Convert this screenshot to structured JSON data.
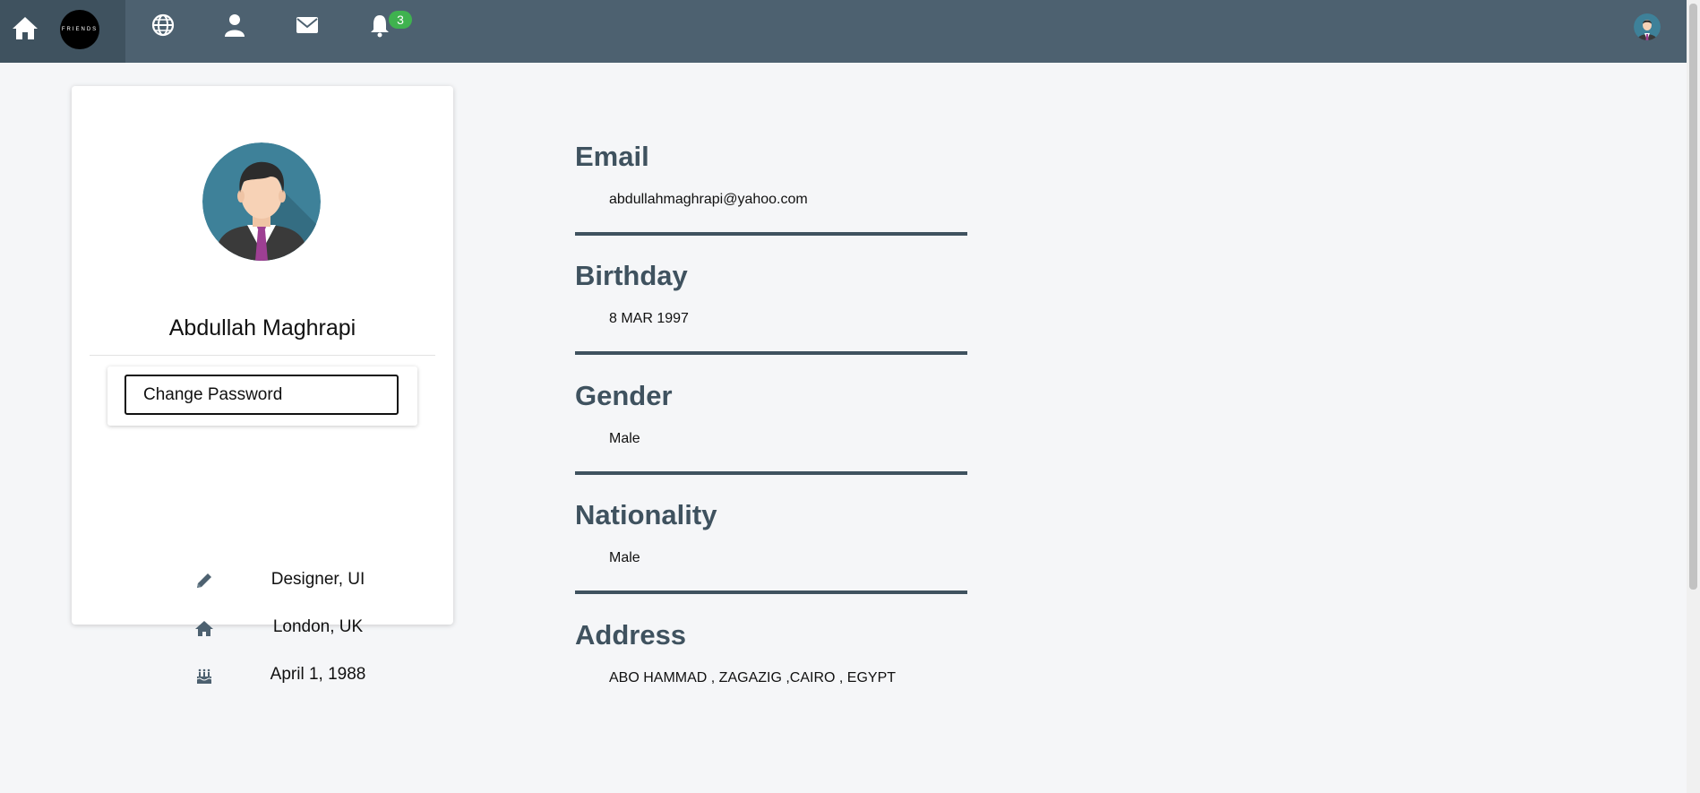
{
  "navbar": {
    "logo_text": "FRIENDS",
    "notification_count": "3",
    "icons": [
      "home-icon",
      "globe-icon",
      "user-icon",
      "envelope-icon",
      "bell-icon"
    ]
  },
  "profile": {
    "name": "Abdullah Maghrapi",
    "change_password_label": "Change Password",
    "job": "Designer, UI",
    "location": "London, UK",
    "birthday": "April 1, 1988"
  },
  "details": [
    {
      "label": "Email",
      "value": "abdullahmaghrapi@yahoo.com"
    },
    {
      "label": "Birthday",
      "value": "8 MAR 1997"
    },
    {
      "label": "Gender",
      "value": "Male"
    },
    {
      "label": "Nationality",
      "value": "Male"
    },
    {
      "label": "Address",
      "value": "ABO HAMMAD , ZAGAZIG ,CAIRO , EGYPT"
    }
  ],
  "colors": {
    "navbar": "#4d6170",
    "navbar_brand": "#3f525f",
    "heading": "#3f525f",
    "badge": "#3fb24f",
    "page_bg": "#f5f6f8"
  }
}
